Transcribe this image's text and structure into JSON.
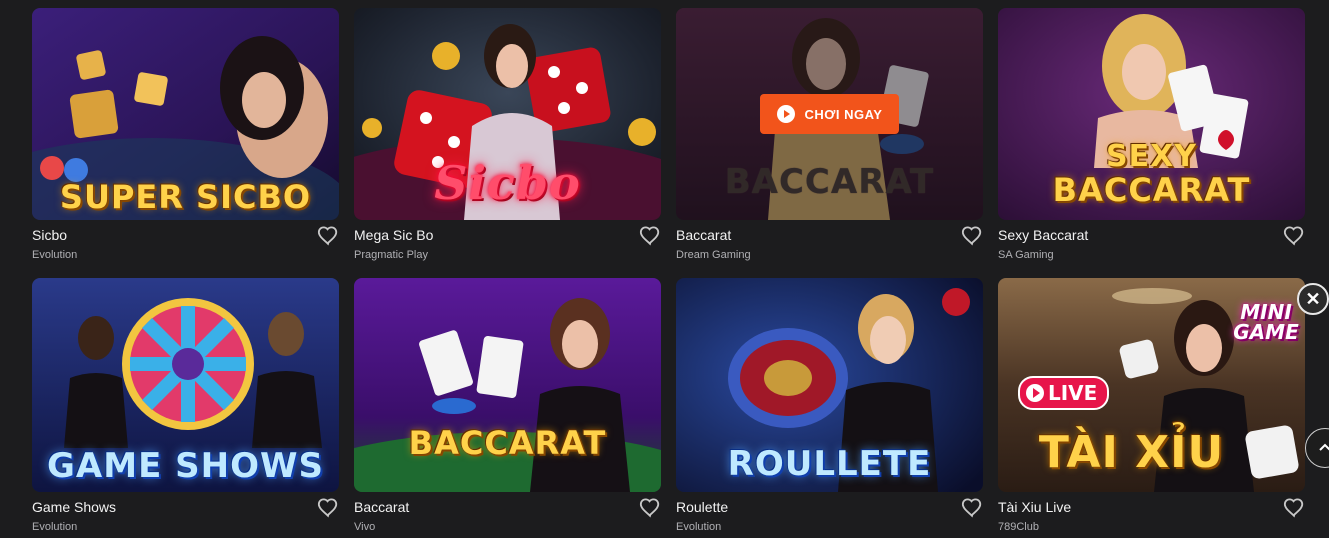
{
  "play_button_label": "CHƠI NGAY",
  "colors": {
    "accent": "#f2541b",
    "background": "#1c1c1e",
    "live_badge": "#e7154a"
  },
  "icons": {
    "favorite": "heart-outline-icon",
    "play": "play-circle-icon",
    "close": "close-icon",
    "scroll_top": "chevron-up-icon"
  },
  "games": [
    {
      "title": "Sicbo",
      "provider": "Evolution",
      "art_text": "SUPER SICBO"
    },
    {
      "title": "Mega Sic Bo",
      "provider": "Pragmatic Play",
      "art_text": "Sicbo"
    },
    {
      "title": "Baccarat",
      "provider": "Dream Gaming",
      "art_text": "BACCARAT"
    },
    {
      "title": "Sexy Baccarat",
      "provider": "SA Gaming",
      "art_text_line1": "SEXY",
      "art_text_line2": "BACCARAT"
    },
    {
      "title": "Game Shows",
      "provider": "Evolution",
      "art_text": "GAME SHOWS"
    },
    {
      "title": "Baccarat",
      "provider": "Vivo",
      "art_text": "BACCARAT"
    },
    {
      "title": "Roulette",
      "provider": "Evolution",
      "art_text": "ROULLETE"
    },
    {
      "title": "Tài Xiu Live",
      "provider": "789Club",
      "art_text": "TÀI XỈU",
      "live_badge": "LIVE",
      "mini_game_line1": "MINI",
      "mini_game_line2": "GAME"
    }
  ]
}
